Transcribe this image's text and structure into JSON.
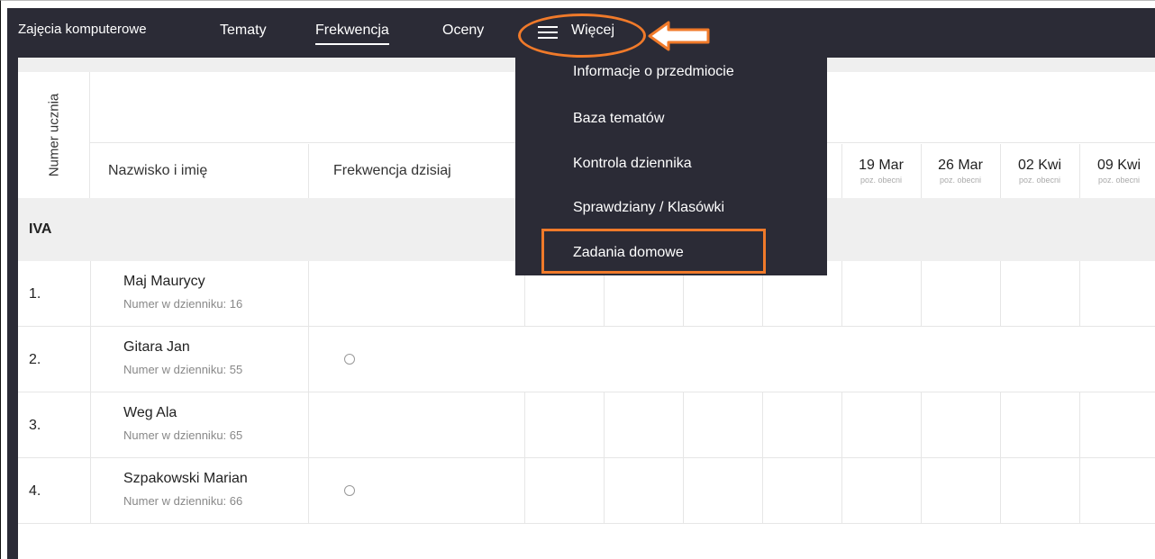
{
  "nav": {
    "title": "Zajęcia komputerowe",
    "tabs": [
      "Tematy",
      "Frekwencja",
      "Oceny"
    ],
    "more_label": "Więcej"
  },
  "dropdown": {
    "items": [
      "Informacje o przedmiocie",
      "Baza tematów",
      "Kontrola dziennika",
      "Sprawdziany / Klasówki",
      "Zadania domowe"
    ]
  },
  "table": {
    "vertical_header": "Numer ucznia",
    "col_name": "Nazwisko i imię",
    "col_today": "Frekwencja dzisiaj",
    "dates": [
      {
        "date": "19 Mar",
        "sub": "poz. obecni"
      },
      {
        "date": "26 Mar",
        "sub": "poz. obecni"
      },
      {
        "date": "02 Kwi",
        "sub": "poz. obecni"
      },
      {
        "date": "09 Kwi",
        "sub": "poz. obecni"
      }
    ],
    "group": "IVA",
    "rows": [
      {
        "num": "1.",
        "name": "Maj Maurycy",
        "sub": "Numer w dzienniku: 16",
        "circle": false
      },
      {
        "num": "2.",
        "name": "Gitara Jan",
        "sub": "Numer w dzienniku: 55",
        "circle": true
      },
      {
        "num": "3.",
        "name": "Weg Ala",
        "sub": "Numer w dzienniku: 65",
        "circle": false
      },
      {
        "num": "4.",
        "name": "Szpakowski Marian",
        "sub": "Numer w dzienniku: 66",
        "circle": true
      }
    ]
  },
  "colors": {
    "nav_bg": "#2b2b36",
    "annotation": "#f07a2a",
    "group_bg": "#efefef"
  }
}
